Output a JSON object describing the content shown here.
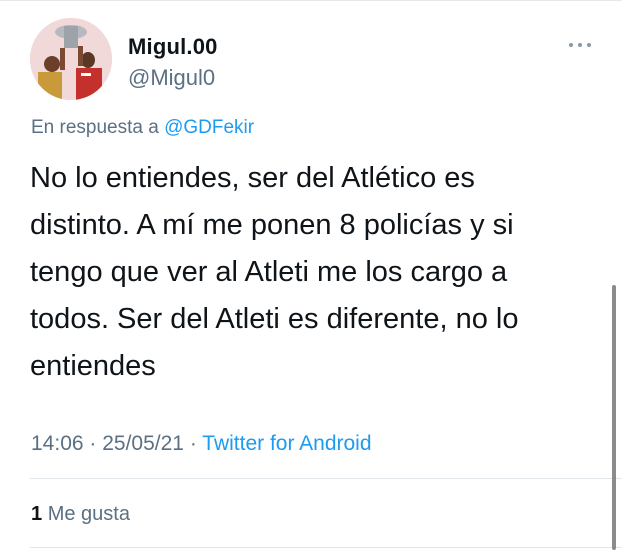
{
  "author": {
    "display_name": "Migul.00",
    "handle": "@Migul0"
  },
  "reply": {
    "prefix": "En respuesta a",
    "mention": "@GDFekir"
  },
  "tweet": {
    "lines": [
      "No lo entiendes, ser del Atlético es",
      "distinto. A mí me ponen 8 policías y si",
      "tengo que ver al Atleti me los cargo a",
      "todos. Ser del Atleti es diferente, no lo",
      "entiendes"
    ]
  },
  "meta": {
    "time": "14:06",
    "separator": " · ",
    "date": "25/05/21",
    "source": "Twitter for Android"
  },
  "stats": {
    "likes_count": "1",
    "likes_label": "Me gusta"
  },
  "icons": {
    "more": "more-horizontal-icon"
  },
  "colors": {
    "link": "#1d9bf0",
    "secondary_text": "#5b7083",
    "primary_text": "#0f1419"
  }
}
